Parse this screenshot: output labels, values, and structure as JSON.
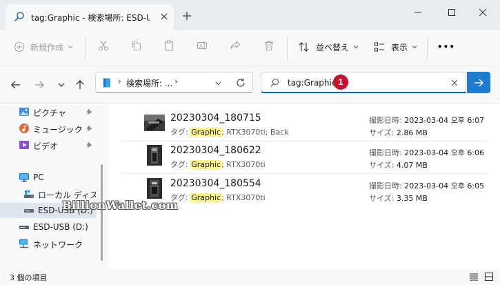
{
  "window": {
    "tab_title": "tag:Graphic - 検索場所: ESD-USB (D:)",
    "icons": {
      "tab": "search-icon",
      "close": "close-icon",
      "new_tab": "plus-icon",
      "minimize": "minimize-icon",
      "maximize": "maximize-icon",
      "close_window": "close-icon"
    }
  },
  "toolbar": {
    "new_label": "新規作成",
    "sort_label": "並べ替え",
    "view_label": "表示",
    "more_label": "•••"
  },
  "address": {
    "crumb": "検索場所: ...",
    "separator": "›"
  },
  "search": {
    "value": "tag:Graphic",
    "marker": "1"
  },
  "sidebar": {
    "items": [
      {
        "label": "ピクチャ",
        "icon": "pictures-icon",
        "pinned": true
      },
      {
        "label": "ミュージック",
        "icon": "music-icon",
        "pinned": true
      },
      {
        "label": "ビデオ",
        "icon": "video-icon",
        "pinned": true
      },
      {
        "label": "PC",
        "icon": "pc-icon",
        "pinned": false
      },
      {
        "label": "ローカル ディスク (C",
        "icon": "disk-icon",
        "pinned": false
      },
      {
        "label": "ESD-USB (D:)",
        "icon": "usb-drive-icon",
        "pinned": false,
        "selected": true
      },
      {
        "label": "ESD-USB (D:)",
        "icon": "usb-drive-icon",
        "pinned": false
      },
      {
        "label": "ネットワーク",
        "icon": "network-icon",
        "pinned": false
      }
    ]
  },
  "files": [
    {
      "name": "20230304_180715",
      "tag_prefix": "タグ: ",
      "tag_hl": "Graphic",
      "tag_rest": "; RTX3070ti; Back",
      "date_label": "撮影日時: ",
      "date": "2023-03-04 오후 6:07",
      "size_label": "サイズ: ",
      "size": "2.86 MB"
    },
    {
      "name": "20230304_180622",
      "tag_prefix": "タグ: ",
      "tag_hl": "Graphic",
      "tag_rest": "; RTX3070ti",
      "date_label": "撮影日時: ",
      "date": "2023-03-04 오후 6:06",
      "size_label": "サイズ: ",
      "size": "4.07 MB"
    },
    {
      "name": "20230304_180554",
      "tag_prefix": "タグ: ",
      "tag_hl": "Graphic",
      "tag_rest": "; RTX3070ti",
      "date_label": "撮影日時: ",
      "date": "2023-03-04 오후 6:05",
      "size_label": "サイズ: ",
      "size": "3.35 MB"
    }
  ],
  "watermark": "BillionWallet.com",
  "status": {
    "count": "3 個の項目"
  },
  "colors": {
    "accent": "#0067c0",
    "search_button": "#1f7ad1",
    "highlight": "#fff58a",
    "marker": "#c8102e"
  }
}
